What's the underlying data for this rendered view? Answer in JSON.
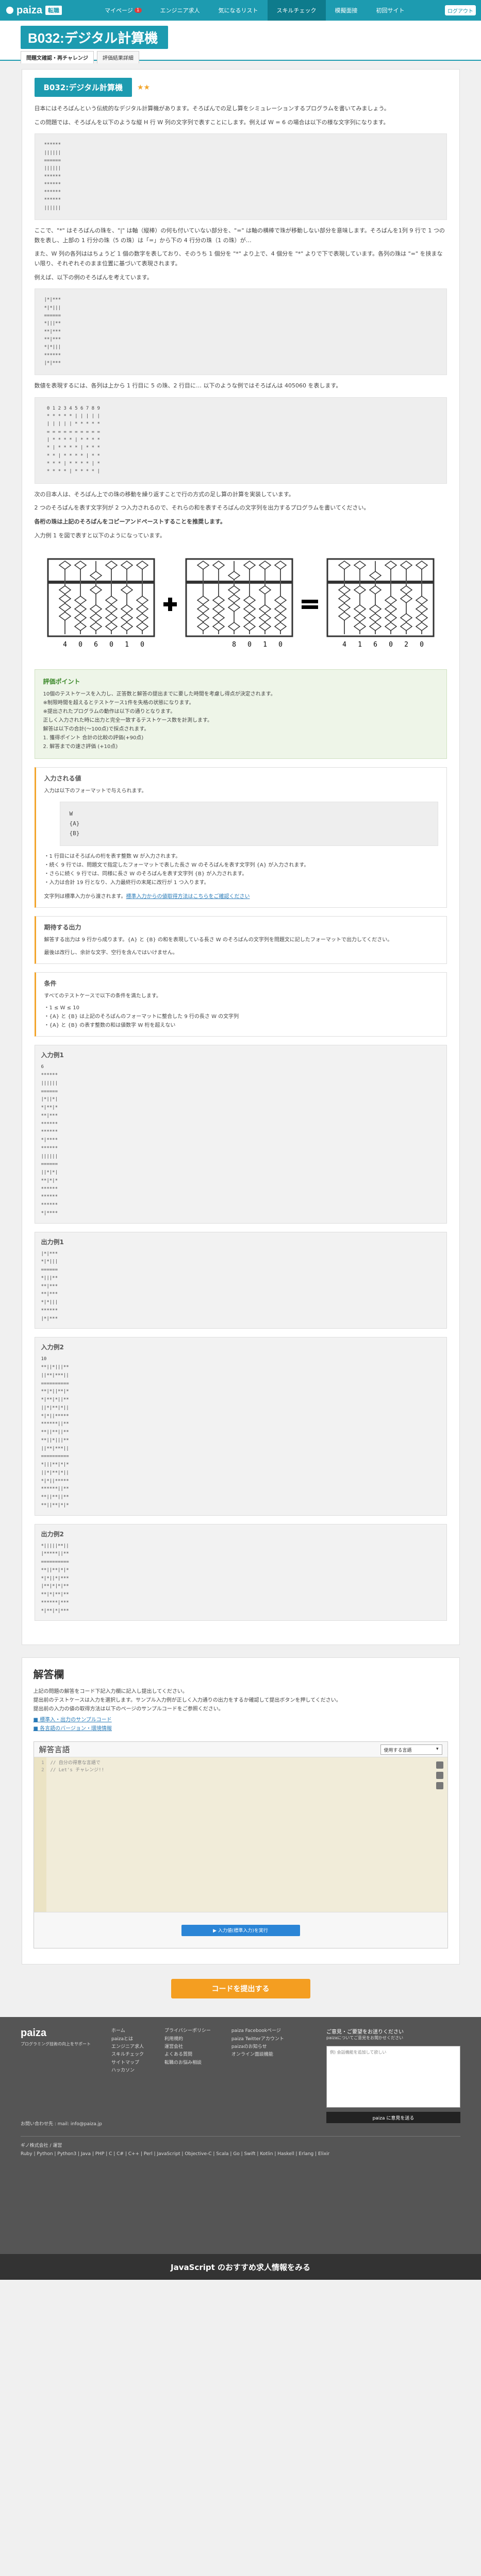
{
  "header": {
    "logo": "paiza",
    "logo_badge": "転職",
    "nav": [
      {
        "label": "マイページ",
        "badge": "1"
      },
      {
        "label": "エンジニア求人"
      },
      {
        "label": "気になるリスト"
      },
      {
        "label": "スキルチェック",
        "active": true
      },
      {
        "label": "模擬面接"
      },
      {
        "label": "初回サイト"
      }
    ],
    "account": "ログアウト"
  },
  "title": {
    "main": "B032:デジタル計算機",
    "tabs": [
      "問題文確認・再チャレンジ",
      "評価結果詳細"
    ]
  },
  "problem": {
    "heading": "B032:デジタル計算機",
    "stars": "★★",
    "p1": "日本にはそろばんという伝統的なデジタル計算機があります。そろばんでの足し算をシミュレーションするプログラムを書いてみましょう。",
    "p2": "この問題では、そろばんを以下のような縦 H 行 W 列の文字列で表すことにします。例えば W = 6 の場合は以下の様な文字列になります。",
    "code1": "******\n||||||\n======\n||||||\n******\n******\n******\n******\n||||||",
    "p3": "ここで、\"*\" はそろばんの珠を、\"|\" は軸（縦棒）の何も付いていない部分を、\"=\" は軸の横棒で珠が移動しない部分を意味します。そろばんを1列 9 行で 1 つの数を表し、上部の 1 行分の珠（5 の珠）は「=」から下の 4 行分の珠（1 の珠）が…",
    "p4": "また、W 列の各列ははちょうど 1 個の数字を表しており、そのうち 1 個分を \"*\" より上で、4 個分を \"*\" よりで下で表現しています。各列の珠は \"=\" を挟まない限り、それぞれそのまま位置に基づいて表現されます。",
    "p5": "例えば、以下の例のそろばんを考えています。",
    "code2": "|*|***\n*|*|||\n======\n*|||**\n**|***\n**|***\n*|*|||\n******\n|*|***",
    "p6": "数値を表現するには、各列は上から 1 行目に 5 の珠、2 行目に… 以下のような例ではそろばんは 405060 を表します。",
    "code3": " 0 1 2 3 4 5 6 7 8 9\n * * * * * | | | | |\n | | | | | * * * * *\n = = = = = = = = = =\n | * * * * | * * * *\n * | * * * * | * * *\n * * | * * * * | * *\n * * * | * * * * | *\n * * * * | * * * * |",
    "p7": "次の日本人は、そろばん上での珠の移動を繰り返すことで行の方式の足し算の計算を実装しています。",
    "p8": "2 つのそろばんを表す文字列が 2 つ入力されるので、それらの和を表すそろばんの文字列を出力するプログラムを書いてください。",
    "p9": "各桁の珠は上記のそろばんをコピーアンドペーストすることを推奨します。",
    "p10": "入力例 1 を図で表すと以下のようになっています。",
    "abacus": {
      "a": "406010",
      "b": "8010",
      "c": "416020",
      "plus": "+",
      "eq": "="
    }
  },
  "scoring": {
    "title": "評価ポイント",
    "lines": [
      "10個のテストケースを入力し、正答数と解答の提出までに要した時間を考慮し得点が決定されます。",
      "※制限時間を超えるとテストケース1件を失格の状態になります。",
      "※提出されたプログラムの動作は以下の通りとなります。",
      "正しく入力された時に出力と完全一致するテストケース数を計測します。",
      "解答は以下の合計(～100点)で採点されます。",
      "1. 獲得ポイント 合計の比較の評価(+90点)",
      "2. 解答までの速さ評価 (+10点)"
    ]
  },
  "input": {
    "title": "入力される値",
    "desc": "入力は以下のフォーマットで与えられます。",
    "format": "W\n{A}\n{B}",
    "notes": [
      "・1 行目にはそろばんの桁を表す整数 W が入力されます。",
      "・続く 9 行では、問題文で指定したフォーマットで表した長さ W のそろばんを表す文字列 {A} が入力されます。",
      "・さらに続く 9 行では、同様に長さ W のそろばんを表す文字列 {B} が入力されます。",
      "・入力は合計 19 行となり、入力最終行の末尾に改行が 1 つ入ります。"
    ],
    "link_prefix": "文字列は標準入力から渡されます。",
    "link": "標準入力からの値取得方法はこちらをご確認ください"
  },
  "output": {
    "title": "期待する出力",
    "desc": "解答する出力は 9 行から成ります。{A} と {B} の和を表現している長さ W のそろばんの文字列を問題文に記したフォーマットで出力してください。",
    "note": "最後は改行し、余計な文字、空行を含んではいけません。"
  },
  "conditions": {
    "title": "条件",
    "intro": "すべてのテストケースで以下の条件を満たします。",
    "lines": [
      "・1 ≤ W ≤ 10",
      "・{A} と {B} は上記のそろばんのフォーマットに整合した 9 行の長さ W の文字列",
      "・{A} と {B} の表す整数の和は値数字 W 桁を超えない"
    ]
  },
  "examples": [
    {
      "title": "入力例1",
      "body": "6\n******\n||||||\n======\n|*||*|\n*|**|*\n**|***\n******\n******\n*|****\n******\n||||||\n======\n||*|*|\n**|*|*\n******\n******\n******\n*|****"
    },
    {
      "title": "出力例1",
      "body": "|*|***\n*|*|||\n======\n*|||**\n**|***\n**|***\n*|*|||\n******\n|*|***"
    },
    {
      "title": "入力例2",
      "body": "10\n**||*|||**\n||**|***||\n==========\n**|*||**|*\n*|**|*||**\n||*|**|*||\n*|*||*****\n******||**\n**||**||**\n**||*|||**\n||**|***||\n==========\n*|||**|*|*\n||*|**|*||\n*|*||*****\n******||**\n**||**||**\n**||**|*|*"
    },
    {
      "title": "出力例2",
      "body": "*|||||**||\n|*****||**\n==========\n**||**|*|*\n*|*||*|***\n|**|*|*|**\n**|*|**|**\n******|***\n*|**|*|***"
    }
  ],
  "answer": {
    "title": "解答欄",
    "intro": "上記の問題の解答をコード下記入力欄に記入し提出してください。",
    "note": "提出前のテストケースは入力を選択します。サンプル入力例が正しく入力通りの出力をするか確認して提出ボタンを押してください。",
    "note2": "提出前の入力の値の取得方法は以下のページのサンプルコードをご参照ください。",
    "links": [
      "■ 標準入・出力のサンプルコード",
      "■ 各言語のバージョン・環境情報"
    ],
    "lang_label": "解答言語",
    "lang_select": "使用する言語",
    "code_lines": [
      "// 自分の得意な言語で",
      "// Let's チャレンジ!!"
    ],
    "run": "▶ 入力値(標準入力)を実行",
    "submit": "コードを提出する"
  },
  "footer": {
    "logo": "paiza",
    "links1": [
      "ホーム",
      "paizaとは",
      "エンジニア求人",
      "スキルチェック",
      "サイトマップ",
      "ハッカソン"
    ],
    "links2": [
      "プライバシーポリシー",
      "利用規約",
      "運営会社",
      "よくある質問",
      "転職のお悩み相談"
    ],
    "links3": [
      "paiza Facebookページ",
      "paiza Twitterアカウント",
      "paizaのお知らせ",
      "オンライン面談機能"
    ],
    "form_title": "ご意見・ご要望をお送りください",
    "form_sub": "paizaについてご意見をお聞かせください",
    "form_placeholder": "例) 会話機能を追加して欲しい",
    "form_btn": "paiza に意見を送る",
    "contact": "お問い合わせ先 : mail: info@paiza.jp",
    "tagline": "プログラミング技術の向上をサポート",
    "company": "ギノ株式会社 / 運営",
    "langs": "Ruby | Python | Python3 | Java | PHP | C | C# | C++ | Perl | JavaScript | Objective-C | Scala | Go | Swift | Kotlin | Haskell | Erlang | Elixir",
    "jsbar": "JavaScript のおすすめ求人情報をみる"
  }
}
